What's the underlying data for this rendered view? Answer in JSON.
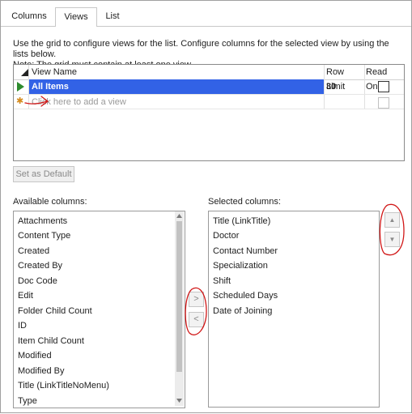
{
  "tabs": [
    {
      "label": "Columns"
    },
    {
      "label": "Views"
    },
    {
      "label": "List"
    }
  ],
  "description": {
    "line1": "Use the grid to configure views for the list. Configure columns for the selected view by using the lists below.",
    "line2": "Note: The grid must contain at least one view."
  },
  "grid": {
    "columns": {
      "view_name": "View Name",
      "row_limit": "Row Limit",
      "read_only": "Read Only"
    },
    "rows": [
      {
        "view_name": "All Items",
        "row_limit": "30",
        "read_only": false
      }
    ],
    "new_row_placeholder": "Click here to add a view"
  },
  "set_default_label": "Set as Default",
  "available": {
    "label": "Available columns:",
    "items": [
      "Attachments",
      "Content Type",
      "Created",
      "Created By",
      "Doc Code",
      "Edit",
      "Folder Child Count",
      "ID",
      "Item Child Count",
      "Modified",
      "Modified By",
      "Title (LinkTitleNoMenu)",
      "Type"
    ]
  },
  "selected": {
    "label": "Selected columns:",
    "items": [
      "Title (LinkTitle)",
      "Doctor",
      "Contact Number",
      "Specialization",
      "Shift",
      "Scheduled Days",
      "Date of Joining"
    ]
  },
  "buttons": {
    "add": ">",
    "remove": "<",
    "up": "▲",
    "down": "▼"
  },
  "colors": {
    "selection": "#3262e6",
    "annotation": "#d11818",
    "row_arrow": "#2e8b2e",
    "new_row_star": "#d48a1c"
  }
}
